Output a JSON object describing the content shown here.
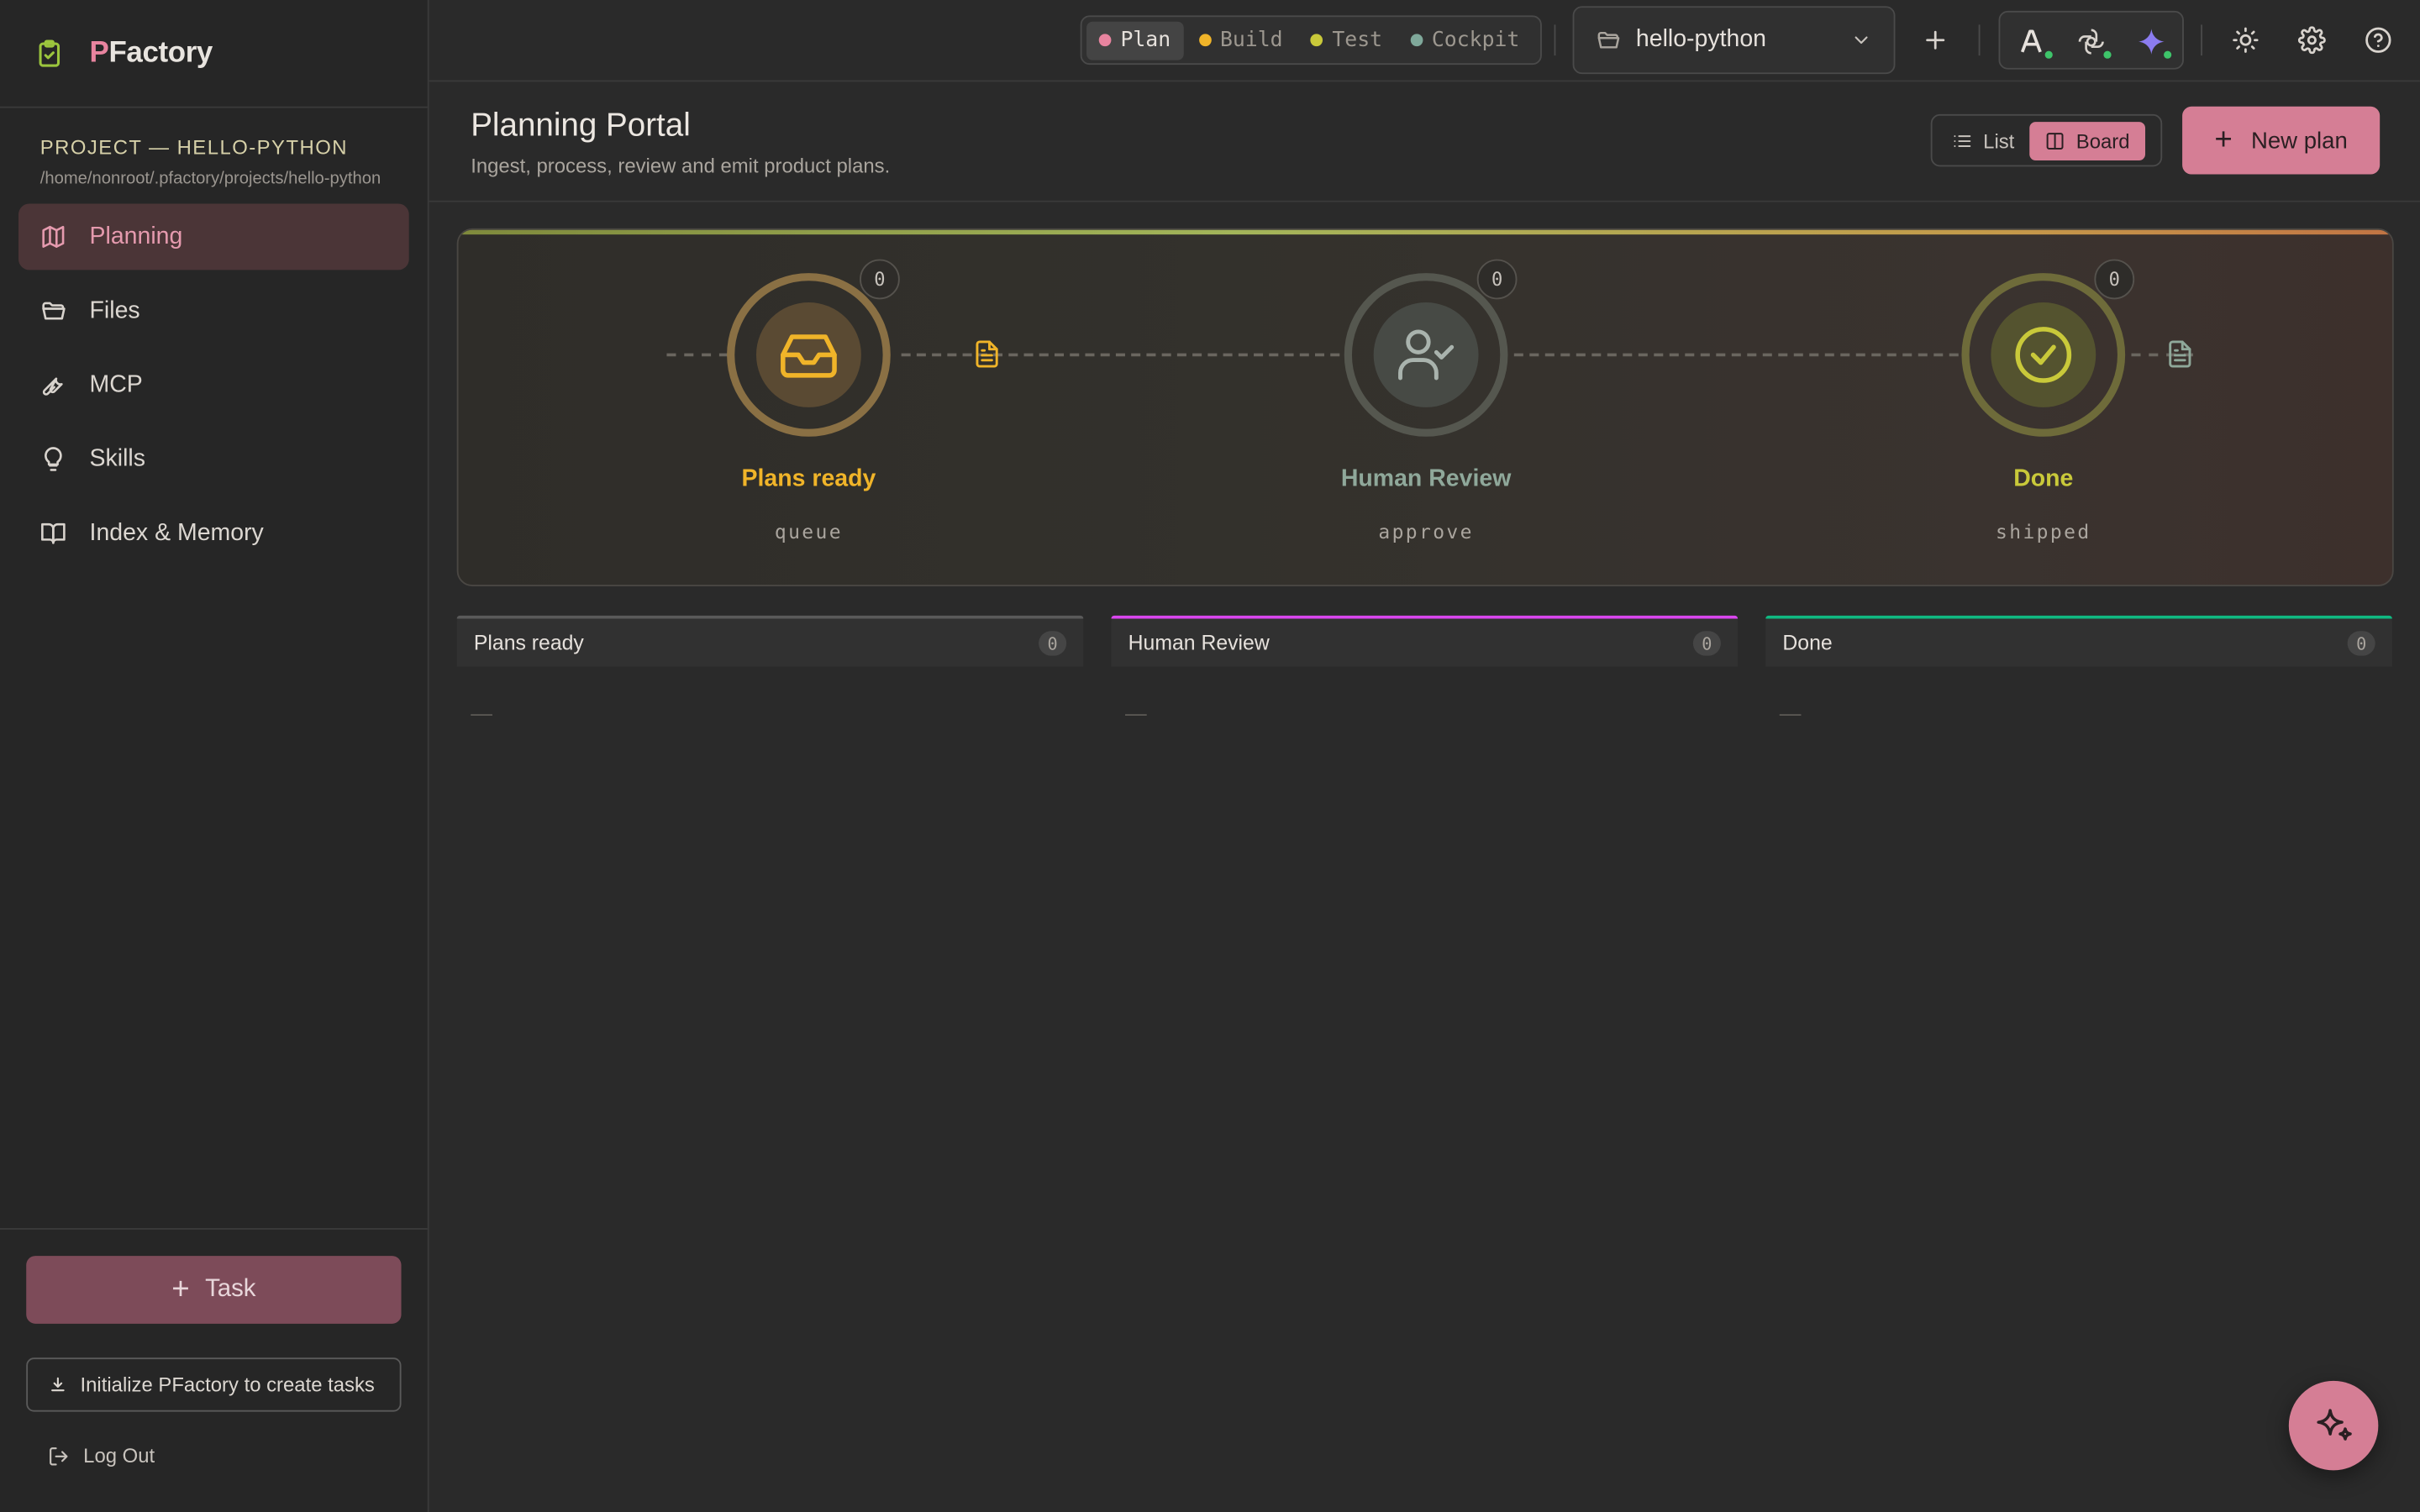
{
  "app": {
    "brand_first": "P",
    "brand_rest": "Factory"
  },
  "sidebar": {
    "project_title": "PROJECT — HELLO-PYTHON",
    "project_path": "/home/nonroot/.pfactory/projects/hello-python",
    "items": [
      {
        "label": "Planning",
        "icon": "map-icon",
        "active": true
      },
      {
        "label": "Files",
        "icon": "folder-icon"
      },
      {
        "label": "MCP",
        "icon": "wrench-icon"
      },
      {
        "label": "Skills",
        "icon": "lightbulb-icon"
      },
      {
        "label": "Index & Memory",
        "icon": "book-icon"
      }
    ],
    "task_button": "Task",
    "init_button": "Initialize PFactory to create tasks",
    "logout": "Log Out"
  },
  "topbar": {
    "modes": [
      {
        "label": "Plan",
        "color": "#e8849f",
        "active": true
      },
      {
        "label": "Build",
        "color": "#f0b429"
      },
      {
        "label": "Test",
        "color": "#c9c93a"
      },
      {
        "label": "Cockpit",
        "color": "#7fa89a"
      }
    ],
    "project_select": "hello-python"
  },
  "page": {
    "title": "Planning Portal",
    "subtitle": "Ingest, process, review and emit product plans.",
    "view_list": "List",
    "view_board": "Board",
    "new_plan": "New plan"
  },
  "pipeline": {
    "stages": [
      {
        "name": "Plans ready",
        "caption": "queue",
        "count": "0",
        "color": "#f0b429"
      },
      {
        "name": "Human Review",
        "caption": "approve",
        "count": "0",
        "color": "#8fa89a"
      },
      {
        "name": "Done",
        "caption": "shipped",
        "count": "0",
        "color": "#c9c93a"
      }
    ]
  },
  "columns": [
    {
      "title": "Plans ready",
      "count": "0",
      "empty": "—",
      "accent": "#5a5a5a"
    },
    {
      "title": "Human Review",
      "count": "0",
      "empty": "—",
      "accent": "#d946ef"
    },
    {
      "title": "Done",
      "count": "0",
      "empty": "—",
      "accent": "#10b981"
    }
  ],
  "colors": {
    "accent": "#d57e95",
    "background": "#2a2a2a",
    "sidebar": "#262626"
  }
}
